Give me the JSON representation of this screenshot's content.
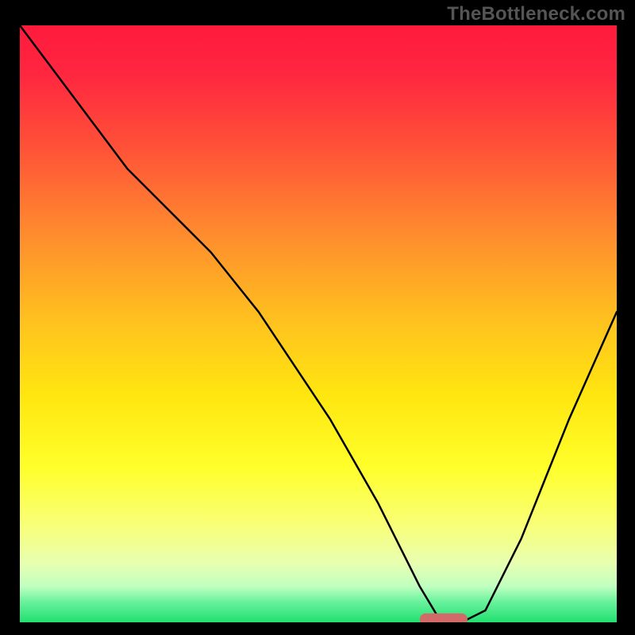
{
  "watermark": "TheBottleneck.com",
  "chart_data": {
    "type": "line",
    "title": "",
    "xlabel": "",
    "ylabel": "",
    "xlim": [
      0,
      100
    ],
    "ylim": [
      0,
      100
    ],
    "grid": false,
    "legend": null,
    "gradient_stops": [
      {
        "offset": 0.0,
        "color": "#ff1a3c"
      },
      {
        "offset": 0.08,
        "color": "#ff2640"
      },
      {
        "offset": 0.2,
        "color": "#ff5038"
      },
      {
        "offset": 0.35,
        "color": "#ff8c2e"
      },
      {
        "offset": 0.5,
        "color": "#ffc31e"
      },
      {
        "offset": 0.62,
        "color": "#ffe610"
      },
      {
        "offset": 0.74,
        "color": "#ffff2a"
      },
      {
        "offset": 0.84,
        "color": "#f8ff7a"
      },
      {
        "offset": 0.9,
        "color": "#e8ffb0"
      },
      {
        "offset": 0.94,
        "color": "#c0ffc0"
      },
      {
        "offset": 0.965,
        "color": "#6bf29d"
      },
      {
        "offset": 1.0,
        "color": "#20e070"
      }
    ],
    "curve": {
      "x": [
        0,
        6,
        12,
        18,
        24,
        28,
        32,
        36,
        40,
        44,
        48,
        52,
        56,
        60,
        64,
        67,
        70,
        74,
        78,
        80,
        84,
        88,
        92,
        96,
        100
      ],
      "y": [
        100,
        92,
        84,
        76,
        70,
        66,
        62,
        57,
        52,
        46,
        40,
        34,
        27,
        20,
        12,
        6,
        1,
        0,
        2,
        6,
        14,
        24,
        34,
        43,
        52
      ]
    },
    "marker": {
      "x": 71,
      "y": 0.5,
      "width": 8,
      "height": 2.0,
      "radius": 1.0,
      "color": "#d26a6a"
    }
  }
}
